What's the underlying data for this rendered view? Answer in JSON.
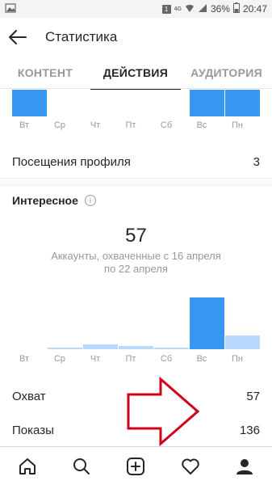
{
  "status_bar": {
    "sim_badge": "1",
    "network": "4G",
    "battery": "36%",
    "time": "20:47"
  },
  "header": {
    "title": "Статистика"
  },
  "tabs": [
    {
      "label": "КОНТЕНТ",
      "active": false
    },
    {
      "label": "ДЕЙСТВИЯ",
      "active": true
    },
    {
      "label": "АУДИТОРИЯ",
      "active": false
    }
  ],
  "profile_visits": {
    "label": "Посещения профиля",
    "value": "3"
  },
  "interesting": {
    "title": "Интересное",
    "reach_number": "57",
    "reach_caption": "Аккаунты, охваченные с 16 апреля по 22 апреля"
  },
  "stats": {
    "reach_label": "Охват",
    "reach_value": "57",
    "impressions_label": "Показы",
    "impressions_value": "136"
  },
  "chart_data": [
    {
      "type": "bar",
      "categories": [
        "Вт",
        "Ср",
        "Чт",
        "Пт",
        "Сб",
        "Вс",
        "Пн"
      ],
      "values": [
        1,
        0,
        0,
        0,
        0,
        1,
        1
      ],
      "note_cropped": true,
      "highlight_color": "#3897f0",
      "light_color": "#b8d9fb"
    },
    {
      "type": "bar",
      "categories": [
        "Вт",
        "Ср",
        "Чт",
        "Пт",
        "Сб",
        "Вс",
        "Пн"
      ],
      "values": [
        0,
        1,
        3,
        2,
        1,
        34,
        9
      ],
      "ylim": [
        0,
        34
      ],
      "highlight_color": "#3897f0",
      "light_color": "#b8d9fb"
    }
  ],
  "colors": {
    "accent": "#3897f0",
    "accent_light": "#b8d9fb",
    "arrow": "#d0021b"
  },
  "icons": {
    "back": "arrow-left-icon",
    "info": "info-icon",
    "home": "home-icon",
    "search": "search-icon",
    "add": "add-post-icon",
    "activity": "heart-icon",
    "profile": "profile-icon"
  }
}
